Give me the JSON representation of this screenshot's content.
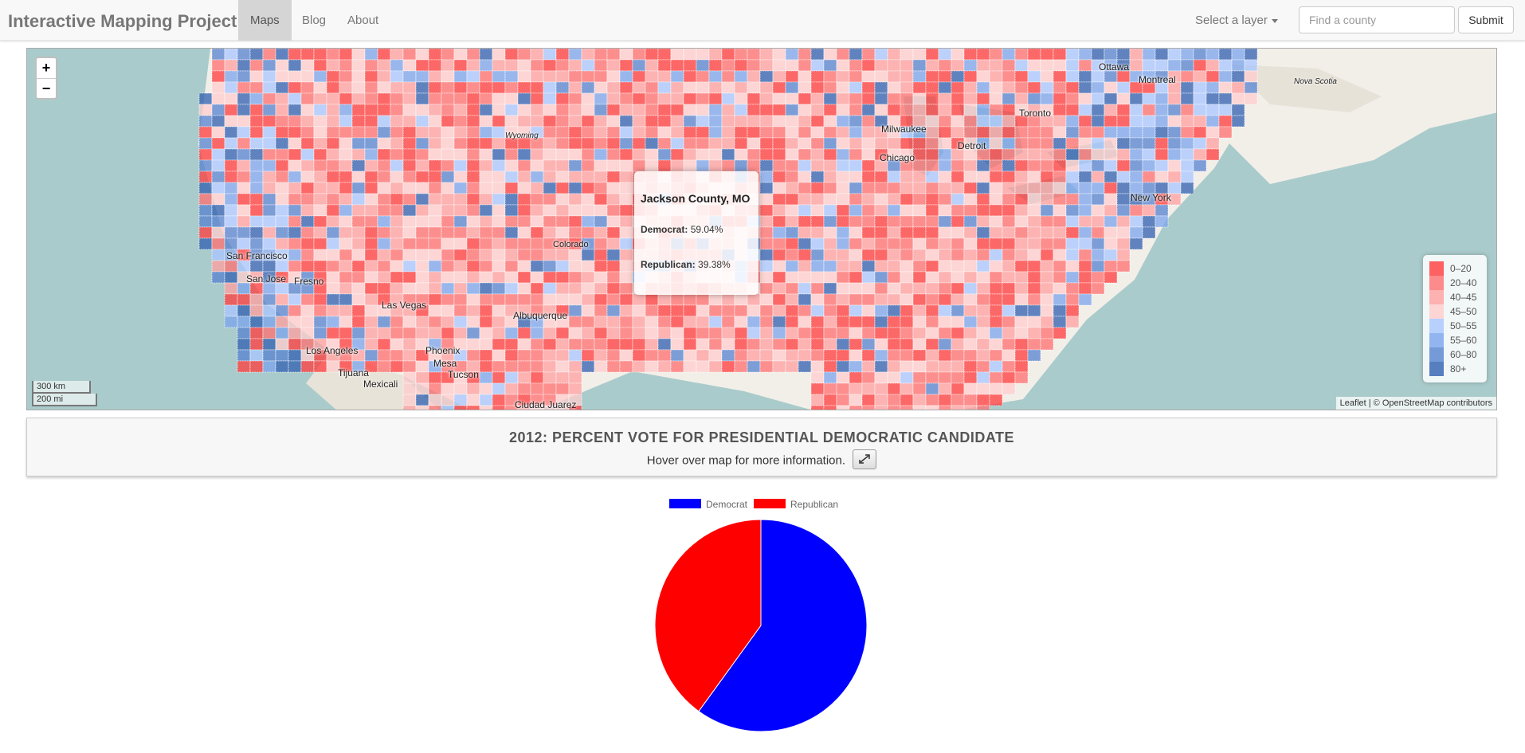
{
  "navbar": {
    "brand": "Interactive Mapping Project",
    "items": [
      "Maps",
      "Blog",
      "About"
    ],
    "active": "Maps",
    "layer_select": "Select a layer",
    "search_placeholder": "Find a county",
    "submit_label": "Submit"
  },
  "map": {
    "zoom_in": "+",
    "zoom_out": "−",
    "scale_km": "300 km",
    "scale_mi": "200 mi",
    "attribution": "Leaflet | © OpenStreetMap contributors",
    "cities": [
      "Ottawa",
      "Montreal",
      "Toronto",
      "Nova Scotia",
      "Milwaukee",
      "Chicago",
      "Detroit",
      "New York",
      "San Francisco",
      "San Jose",
      "Los Angeles",
      "Tijuana",
      "Mexicali",
      "Phoenix",
      "Mesa",
      "Tucson",
      "Las Vegas",
      "Albuquerque",
      "Ciudad Juarez",
      "Fresno",
      "Colorado",
      "Wyoming"
    ],
    "popup": {
      "county": "Jackson County, MO",
      "dem_label": "Democrat:",
      "dem_value": "59.04%",
      "rep_label": "Republican:",
      "rep_value": "39.38%"
    },
    "legend": [
      {
        "label": "0–20",
        "color": "#ff3b3b"
      },
      {
        "label": "20–40",
        "color": "#ff6f6f"
      },
      {
        "label": "40–45",
        "color": "#ff9f9f"
      },
      {
        "label": "45–50",
        "color": "#ffcccc"
      },
      {
        "label": "50–55",
        "color": "#a8c6ff"
      },
      {
        "label": "55–60",
        "color": "#7ba4ec"
      },
      {
        "label": "60–80",
        "color": "#5582d0"
      },
      {
        "label": "80+",
        "color": "#2f5fb0"
      }
    ]
  },
  "info": {
    "title": "2012: PERCENT VOTE FOR PRESIDENTIAL DEMOCRATIC CANDIDATE",
    "subtitle": "Hover over map for more information."
  },
  "chart_data": {
    "type": "pie",
    "labels": [
      "Democrat",
      "Republican"
    ],
    "values": [
      59.04,
      39.38
    ],
    "colors": [
      "#0000ff",
      "#ff0000"
    ],
    "legend_position": "top"
  }
}
